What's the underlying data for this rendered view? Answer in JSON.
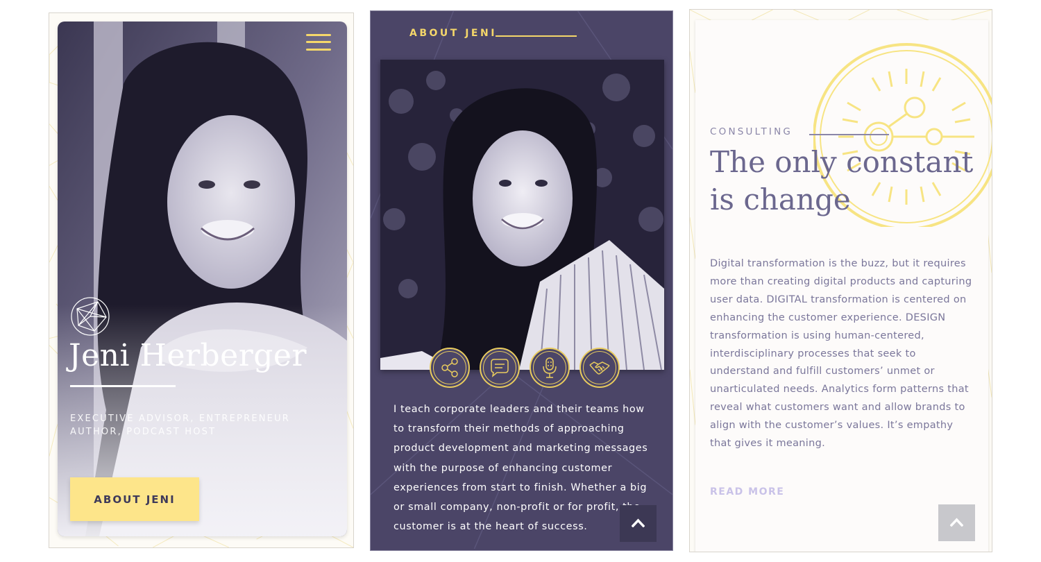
{
  "hero": {
    "name": "Jeni Herberger",
    "subtitle_line1": "EXECUTIVE ADVISOR, ENTREPRENEUR",
    "subtitle_line2": "AUTHOR, PODCAST HOST",
    "cta_label": "ABOUT JENI",
    "menu_icon": "hamburger-menu-icon",
    "logo_icon": "globe-network-icon"
  },
  "about": {
    "heading": "ABOUT JENI",
    "service_icons": [
      "share-network-icon",
      "chat-bubble-icon",
      "microphone-icon",
      "handshake-icon"
    ],
    "body": "I teach corporate leaders and their teams how to transform their methods of approaching product development and marketing messages with the purpose of enhancing customer experiences from start to finish. Whether a big or small company, non-profit or for profit, the customer is at the heart of success.",
    "scroll_top_icon": "chevron-up-icon"
  },
  "consulting": {
    "label": "CONSULTING",
    "title": "The only constant is change",
    "body": "Digital transformation is the buzz, but it requires more than creating digital products and capturing user data. DIGITAL transformation is centered on enhancing the customer experience. DESIGN transformation is using human-centered, interdisciplinary processes that seek to understand and fulfill customers’ unmet or unarticulated needs. Analytics form patterns that reveal what customers want and allow brands to align with the customer’s values. It’s empathy that gives it meaning.",
    "read_more": "READ MORE",
    "scroll_top_icon": "chevron-up-icon"
  },
  "colors": {
    "accent_yellow": "#fde58a",
    "deep_purple": "#4b4567",
    "muted_purple": "#6b678e",
    "light_lavender": "#c9c2e8"
  }
}
